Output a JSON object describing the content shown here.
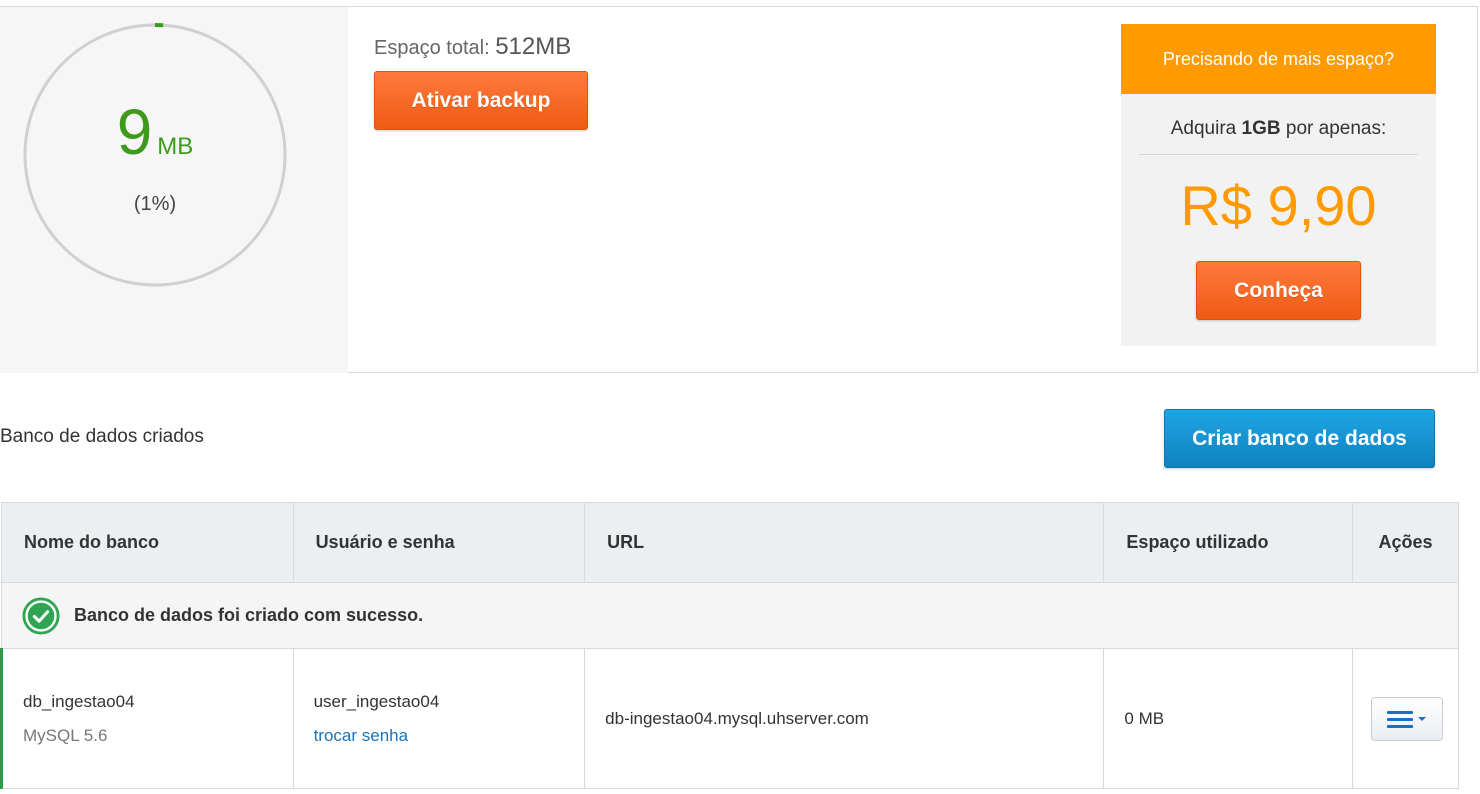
{
  "usage": {
    "value": "9",
    "unit": "MB",
    "percent_label": "(1%)",
    "percent": 0.01,
    "color": "#3d9a1b"
  },
  "space": {
    "label": "Espaço total:",
    "value": "512MB"
  },
  "buttons": {
    "backup": "Ativar backup",
    "create_db": "Criar banco de dados",
    "conheca": "Conheça"
  },
  "promo": {
    "header": "Precisando de mais espaço?",
    "line_pre": "Adquira",
    "line_bold": "1GB",
    "line_post": "por apenas:",
    "price": "R$ 9,90",
    "accent": "#ff9a00"
  },
  "section": {
    "title": "Banco de dados criados"
  },
  "table": {
    "headers": [
      "Nome do banco",
      "Usuário e senha",
      "URL",
      "Espaço utilizado",
      "Ações"
    ],
    "success_message": "Banco de dados foi criado com sucesso.",
    "rows": [
      {
        "name": "db_ingestao04",
        "version": "MySQL 5.6",
        "user": "user_ingestao04",
        "change_password": "trocar senha",
        "url": "db-ingestao04.mysql.uhserver.com",
        "used": "0 MB",
        "action_icon": "menu-icon"
      }
    ]
  }
}
